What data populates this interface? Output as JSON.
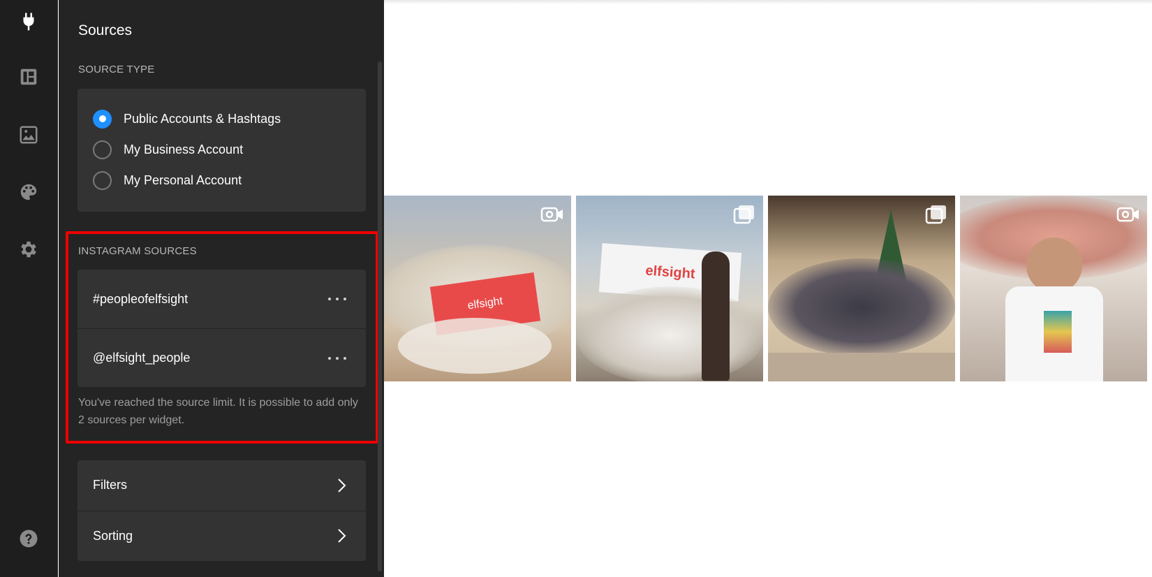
{
  "rail": {
    "icons": [
      "plug-icon",
      "layout-icon",
      "image-icon",
      "palette-icon",
      "gear-icon",
      "help-icon"
    ]
  },
  "panel": {
    "title": "Sources",
    "source_type": {
      "label": "SOURCE TYPE",
      "options": [
        {
          "label": "Public Accounts & Hashtags",
          "checked": true
        },
        {
          "label": "My Business Account",
          "checked": false
        },
        {
          "label": "My Personal Account",
          "checked": false
        }
      ]
    },
    "instagram_sources": {
      "label": "INSTAGRAM SOURCES",
      "items": [
        "#peopleofelfsight",
        "@elfsight_people"
      ],
      "limit_note": "You've reached the source limit. It is possible to add only 2 sources per widget."
    },
    "nav": [
      {
        "label": "Filters"
      },
      {
        "label": "Sorting"
      }
    ]
  },
  "preview": {
    "tiles": [
      {
        "media": "video-icon",
        "banner_text": "elfsight"
      },
      {
        "media": "gallery-icon",
        "banner_text": "elfsight"
      },
      {
        "media": "gallery-icon"
      },
      {
        "media": "video-icon"
      }
    ]
  },
  "colors": {
    "accent": "#1e90ff",
    "highlight": "#ee0000",
    "rail_bg": "#1e1e1e",
    "panel_bg": "#242424",
    "card_bg": "#333333"
  }
}
